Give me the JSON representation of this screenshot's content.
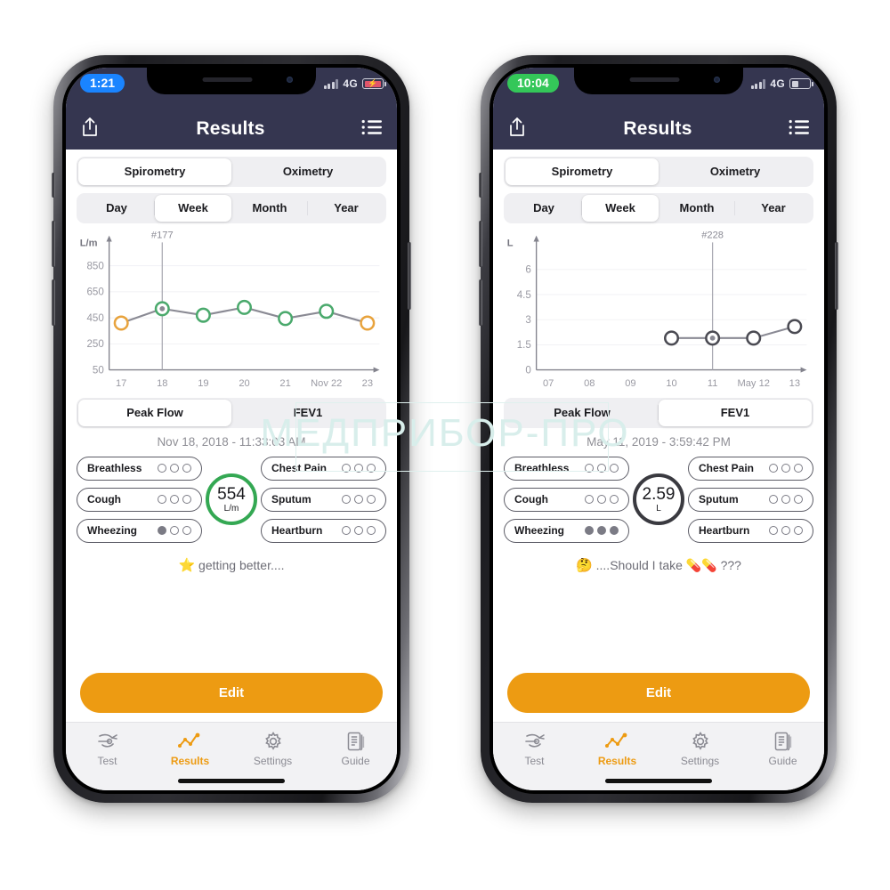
{
  "watermark": {
    "text": "МЕДПРИБОР-ПРО"
  },
  "phones": [
    {
      "id": "left",
      "status": {
        "time": "1:21",
        "time_style": "blue",
        "network": "4G",
        "battery": "charging"
      },
      "nav": {
        "title": "Results",
        "share_icon": "share-icon",
        "list_icon": "list-icon"
      },
      "mode_segment": {
        "options": [
          "Spirometry",
          "Oximetry"
        ],
        "active": "Spirometry"
      },
      "range_segment": {
        "options": [
          "Day",
          "Week",
          "Month",
          "Year"
        ],
        "active": "Week"
      },
      "chart_data": {
        "type": "line",
        "title": "#177",
        "marker_label": "#177",
        "ylabel": "L/m",
        "xlabel": "",
        "ytick_labels": [
          "850",
          "650",
          "450",
          "250",
          "50"
        ],
        "yticks": [
          850,
          650,
          450,
          250,
          50
        ],
        "ylim": [
          50,
          950
        ],
        "categories": [
          "17",
          "18",
          "19",
          "20",
          "21",
          "Nov 22",
          "23"
        ],
        "values": [
          410,
          520,
          470,
          530,
          445,
          500,
          410
        ],
        "point_colors": [
          "#e8a33d",
          "#4aa96c",
          "#4aa96c",
          "#4aa96c",
          "#4aa96c",
          "#4aa96c",
          "#e8a33d"
        ],
        "selected_index": 1,
        "grid": true,
        "legend": "none"
      },
      "metric_segment": {
        "options": [
          "Peak Flow",
          "FEV1"
        ],
        "active": "Peak Flow"
      },
      "datetime": "Nov 18, 2018 - 11:33:03 AM",
      "symptoms_left": [
        {
          "label": "Breathless",
          "filled": 0,
          "total": 3
        },
        {
          "label": "Cough",
          "filled": 0,
          "total": 3
        },
        {
          "label": "Wheezing",
          "filled": 1,
          "total": 3
        }
      ],
      "symptoms_right": [
        {
          "label": "Chest Pain",
          "filled": 0,
          "total": 3
        },
        {
          "label": "Sputum",
          "filled": 0,
          "total": 3
        },
        {
          "label": "Heartburn",
          "filled": 0,
          "total": 3
        }
      ],
      "score": {
        "value": "554",
        "unit": "L/m",
        "ring_color": "#34a853"
      },
      "note": {
        "emoji": "⭐",
        "text": "getting better...."
      },
      "edit_label": "Edit",
      "tabs": [
        {
          "label": "Test",
          "icon": "spirometer-icon",
          "active": false
        },
        {
          "label": "Results",
          "icon": "chart-line-icon",
          "active": true
        },
        {
          "label": "Settings",
          "icon": "gear-icon",
          "active": false
        },
        {
          "label": "Guide",
          "icon": "document-icon",
          "active": false
        }
      ]
    },
    {
      "id": "right",
      "status": {
        "time": "10:04",
        "time_style": "green",
        "network": "4G",
        "battery": "normal"
      },
      "nav": {
        "title": "Results",
        "share_icon": "share-icon",
        "list_icon": "list-icon"
      },
      "mode_segment": {
        "options": [
          "Spirometry",
          "Oximetry"
        ],
        "active": "Spirometry"
      },
      "range_segment": {
        "options": [
          "Day",
          "Week",
          "Month",
          "Year"
        ],
        "active": "Week"
      },
      "chart_data": {
        "type": "line",
        "title": "#228",
        "marker_label": "#228",
        "ylabel": "L",
        "xlabel": "",
        "ytick_labels": [
          "6",
          "4.5",
          "3",
          "1.5",
          "0"
        ],
        "yticks": [
          6,
          4.5,
          3,
          1.5,
          0
        ],
        "ylim": [
          0,
          7
        ],
        "categories": [
          "07",
          "08",
          "09",
          "10",
          "11",
          "May 12",
          "13"
        ],
        "values": [
          null,
          null,
          null,
          1.9,
          1.9,
          1.9,
          2.59
        ],
        "point_colors": [
          null,
          null,
          null,
          "#4a4a52",
          "#4a4a52",
          "#4a4a52",
          "#4a4a52"
        ],
        "selected_index": 4,
        "grid": true,
        "legend": "none"
      },
      "metric_segment": {
        "options": [
          "Peak Flow",
          "FEV1"
        ],
        "active": "FEV1"
      },
      "datetime": "May 11, 2019 - 3:59:42 PM",
      "symptoms_left": [
        {
          "label": "Breathless",
          "filled": 0,
          "total": 3
        },
        {
          "label": "Cough",
          "filled": 0,
          "total": 3
        },
        {
          "label": "Wheezing",
          "filled": 3,
          "total": 3
        }
      ],
      "symptoms_right": [
        {
          "label": "Chest Pain",
          "filled": 0,
          "total": 3
        },
        {
          "label": "Sputum",
          "filled": 0,
          "total": 3
        },
        {
          "label": "Heartburn",
          "filled": 0,
          "total": 3
        }
      ],
      "score": {
        "value": "2.59",
        "unit": "L",
        "ring_color": "#3a3a40"
      },
      "note": {
        "emoji": "🤔",
        "text": "....Should I take 💊💊 ???"
      },
      "edit_label": "Edit",
      "tabs": [
        {
          "label": "Test",
          "icon": "spirometer-icon",
          "active": false
        },
        {
          "label": "Results",
          "icon": "chart-line-icon",
          "active": true
        },
        {
          "label": "Settings",
          "icon": "gear-icon",
          "active": false
        },
        {
          "label": "Guide",
          "icon": "document-icon",
          "active": false
        }
      ]
    }
  ]
}
